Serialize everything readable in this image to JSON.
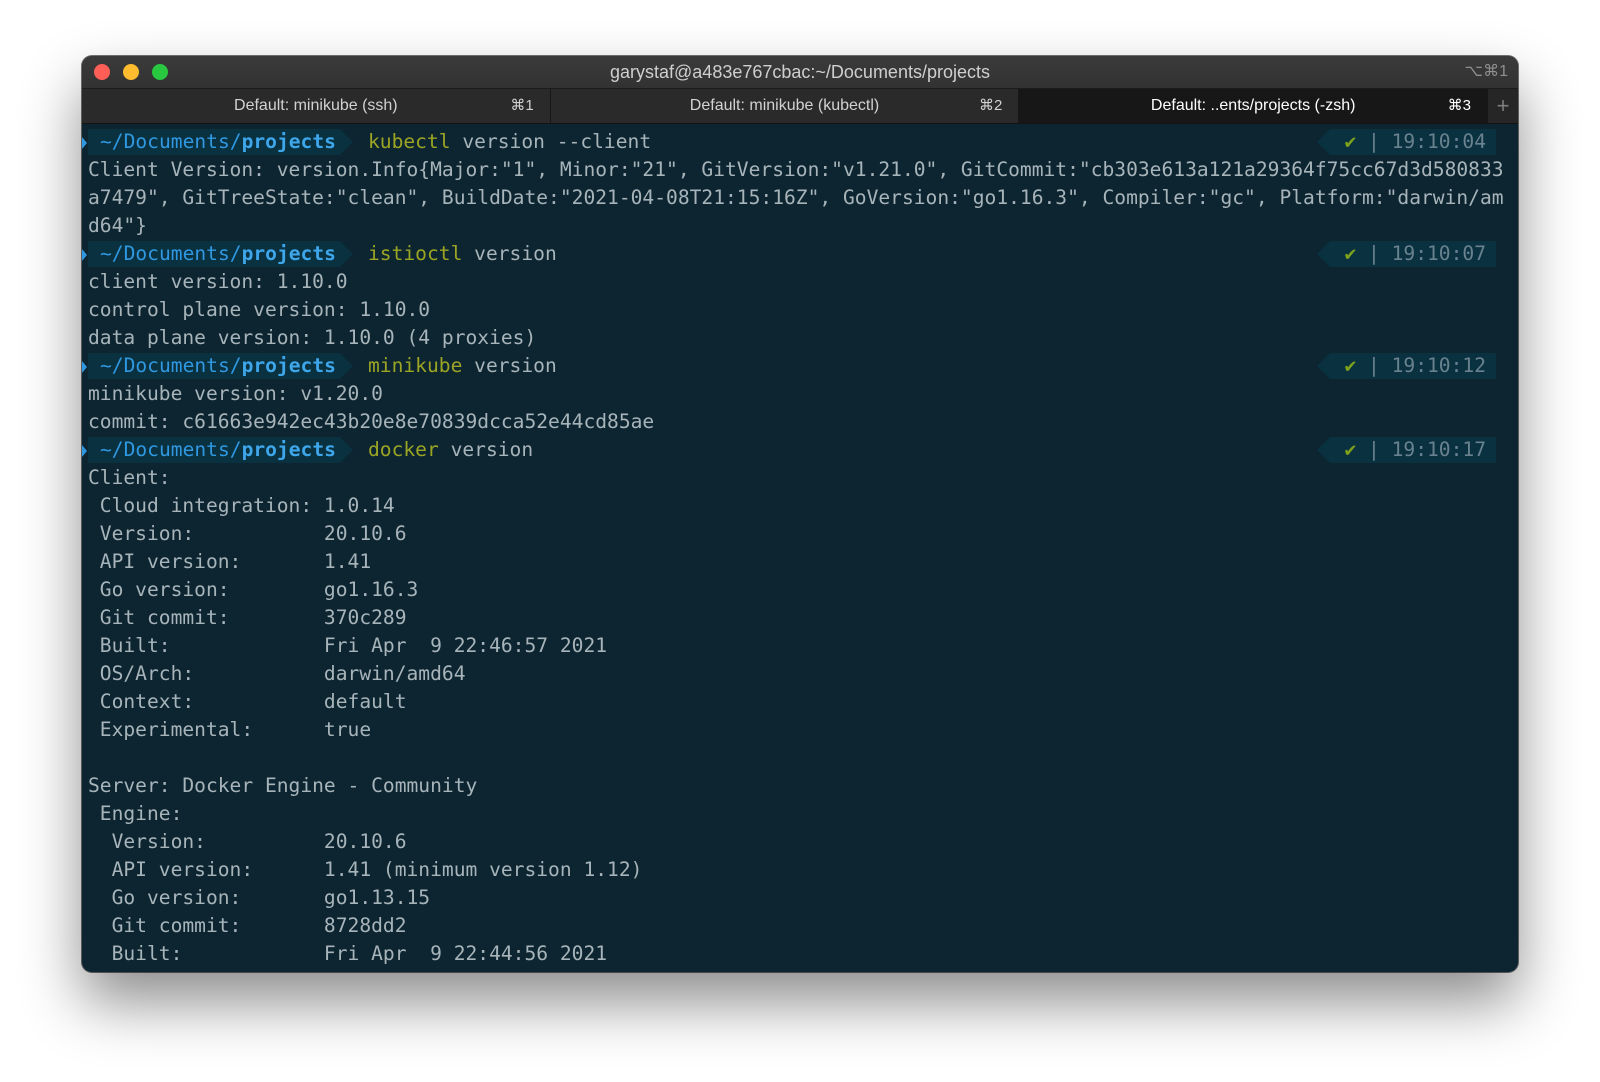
{
  "window": {
    "title": "garystaf@a483e767cbac:~/Documents/projects",
    "title_shortcut": "⌥⌘1"
  },
  "tabs": [
    {
      "label": "Default: minikube (ssh)",
      "shortcut": "⌘1"
    },
    {
      "label": "Default: minikube (kubectl)",
      "shortcut": "⌘2"
    },
    {
      "label": "Default: ..ents/projects (-zsh)",
      "shortcut": "⌘3"
    }
  ],
  "tab_add_label": "+",
  "prompt": {
    "path_prefix": "~/Documents/",
    "path_dir": "projects",
    "status_icon": "✔",
    "separator": "|"
  },
  "commands": [
    {
      "program": "kubectl",
      "args": " version --client",
      "time": "19:10:04",
      "output": [
        "Client Version: version.Info{Major:\"1\", Minor:\"21\", GitVersion:\"v1.21.0\", GitCommit:\"cb303e613a121a29364f75cc67d3d580833",
        "a7479\", GitTreeState:\"clean\", BuildDate:\"2021-04-08T21:15:16Z\", GoVersion:\"go1.16.3\", Compiler:\"gc\", Platform:\"darwin/am",
        "d64\"}"
      ]
    },
    {
      "program": "istioctl",
      "args": " version",
      "time": "19:10:07",
      "output": [
        "client version: 1.10.0",
        "control plane version: 1.10.0",
        "data plane version: 1.10.0 (4 proxies)"
      ]
    },
    {
      "program": "minikube",
      "args": " version",
      "time": "19:10:12",
      "output": [
        "minikube version: v1.20.0",
        "commit: c61663e942ec43b20e8e70839dcca52e44cd85ae"
      ]
    },
    {
      "program": "docker",
      "args": " version",
      "time": "19:10:17",
      "output": [
        "Client:",
        " Cloud integration: 1.0.14",
        " Version:           20.10.6",
        " API version:       1.41",
        " Go version:        go1.16.3",
        " Git commit:        370c289",
        " Built:             Fri Apr  9 22:46:57 2021",
        " OS/Arch:           darwin/amd64",
        " Context:           default",
        " Experimental:      true",
        "",
        "Server: Docker Engine - Community",
        " Engine:",
        "  Version:          20.10.6",
        "  API version:      1.41 (minimum version 1.12)",
        "  Go version:       go1.13.15",
        "  Git commit:       8728dd2",
        "  Built:            Fri Apr  9 22:44:56 2021"
      ]
    }
  ]
}
